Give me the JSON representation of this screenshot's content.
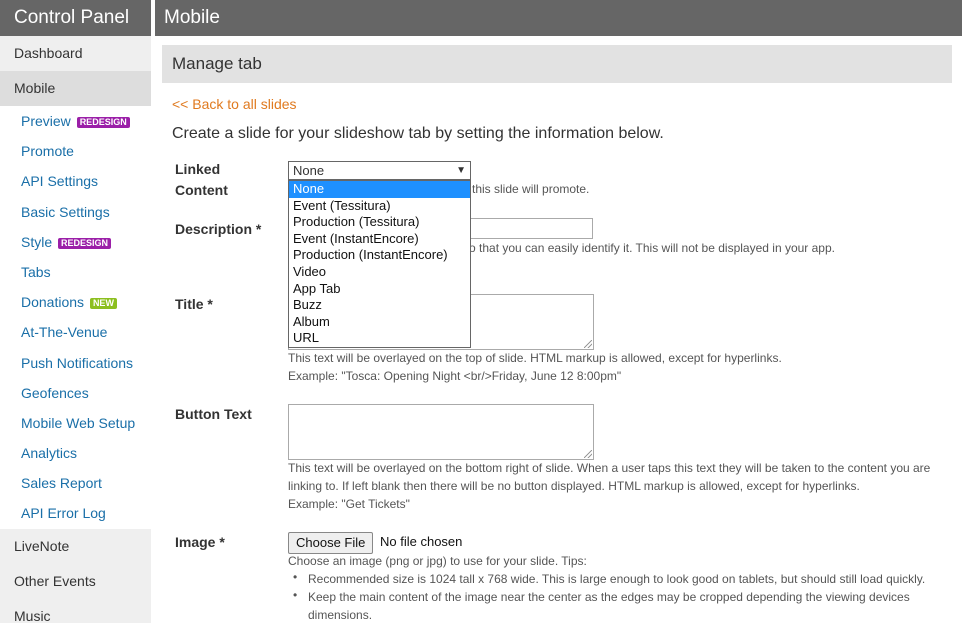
{
  "sidebar": {
    "title": "Control Panel",
    "top_items": [
      {
        "label": "Dashboard"
      },
      {
        "label": "Mobile"
      }
    ],
    "sub_items": [
      {
        "label": "Preview",
        "badge": "REDESIGN"
      },
      {
        "label": "Promote"
      },
      {
        "label": "API Settings"
      },
      {
        "label": "Basic Settings"
      },
      {
        "label": "Style",
        "badge": "REDESIGN"
      },
      {
        "label": "Tabs"
      },
      {
        "label": "Donations",
        "badge": "NEW"
      },
      {
        "label": "At-The-Venue"
      },
      {
        "label": "Push Notifications"
      },
      {
        "label": "Geofences"
      },
      {
        "label": "Mobile Web Setup"
      },
      {
        "label": "Analytics"
      },
      {
        "label": "Sales Report"
      },
      {
        "label": "API Error Log"
      }
    ],
    "bottom_items": [
      {
        "label": "LiveNote"
      },
      {
        "label": "Other Events"
      },
      {
        "label": "Music"
      }
    ]
  },
  "header": {
    "title": "Mobile"
  },
  "main": {
    "section_title": "Manage tab",
    "back_link": "<< Back to all slides",
    "intro": "Create a slide for your slideshow tab by setting the information below.",
    "linked_content": {
      "label_line1": "Linked",
      "label_line2": "Content",
      "selected": "None",
      "options": [
        "None",
        "Event (Tessitura)",
        "Production (Tessitura)",
        "Event (InstantEncore)",
        "Production (InstantEncore)",
        "Video",
        "App Tab",
        "Buzz",
        "Album",
        "URL"
      ],
      "help_partial": "this slide will promote."
    },
    "description": {
      "label": "Description *",
      "value": "",
      "help_partial": "o that you can easily identify it. This will not be displayed in your app."
    },
    "title_field": {
      "label": "Title *",
      "value": "",
      "help": "This text will be overlayed on the top of slide. HTML markup is allowed, except for hyperlinks.",
      "example": "Example: \"Tosca: Opening Night <br/>Friday, June 12 8:00pm\""
    },
    "button_text": {
      "label": "Button Text",
      "value": "",
      "help_line1": "This text will be overlayed on the bottom right of slide. When a user taps this text they will be taken to the content you are",
      "help_line2": "linking to. If left blank then there will be no button displayed. HTML markup is allowed, except for hyperlinks.",
      "example": "Example: \"Get Tickets\""
    },
    "image": {
      "label": "Image *",
      "button": "Choose File",
      "status": "No file chosen",
      "help": "Choose an image (png or jpg) to use for your slide. Tips:",
      "tips": [
        "Recommended size is 1024 tall x 768 wide. This is large enough to look good on tablets, but should still load quickly.",
        "Keep the main content of the image near the center as the edges may be cropped depending the viewing devices",
        "dimensions."
      ]
    }
  },
  "colors": {
    "header_bg": "#666666",
    "link_blue": "#1a6fa8",
    "back_link_orange": "#e07a1f",
    "badge_redesign": "#9b1fa8",
    "badge_new": "#8cbf1f",
    "select_highlight": "#1e90ff"
  }
}
